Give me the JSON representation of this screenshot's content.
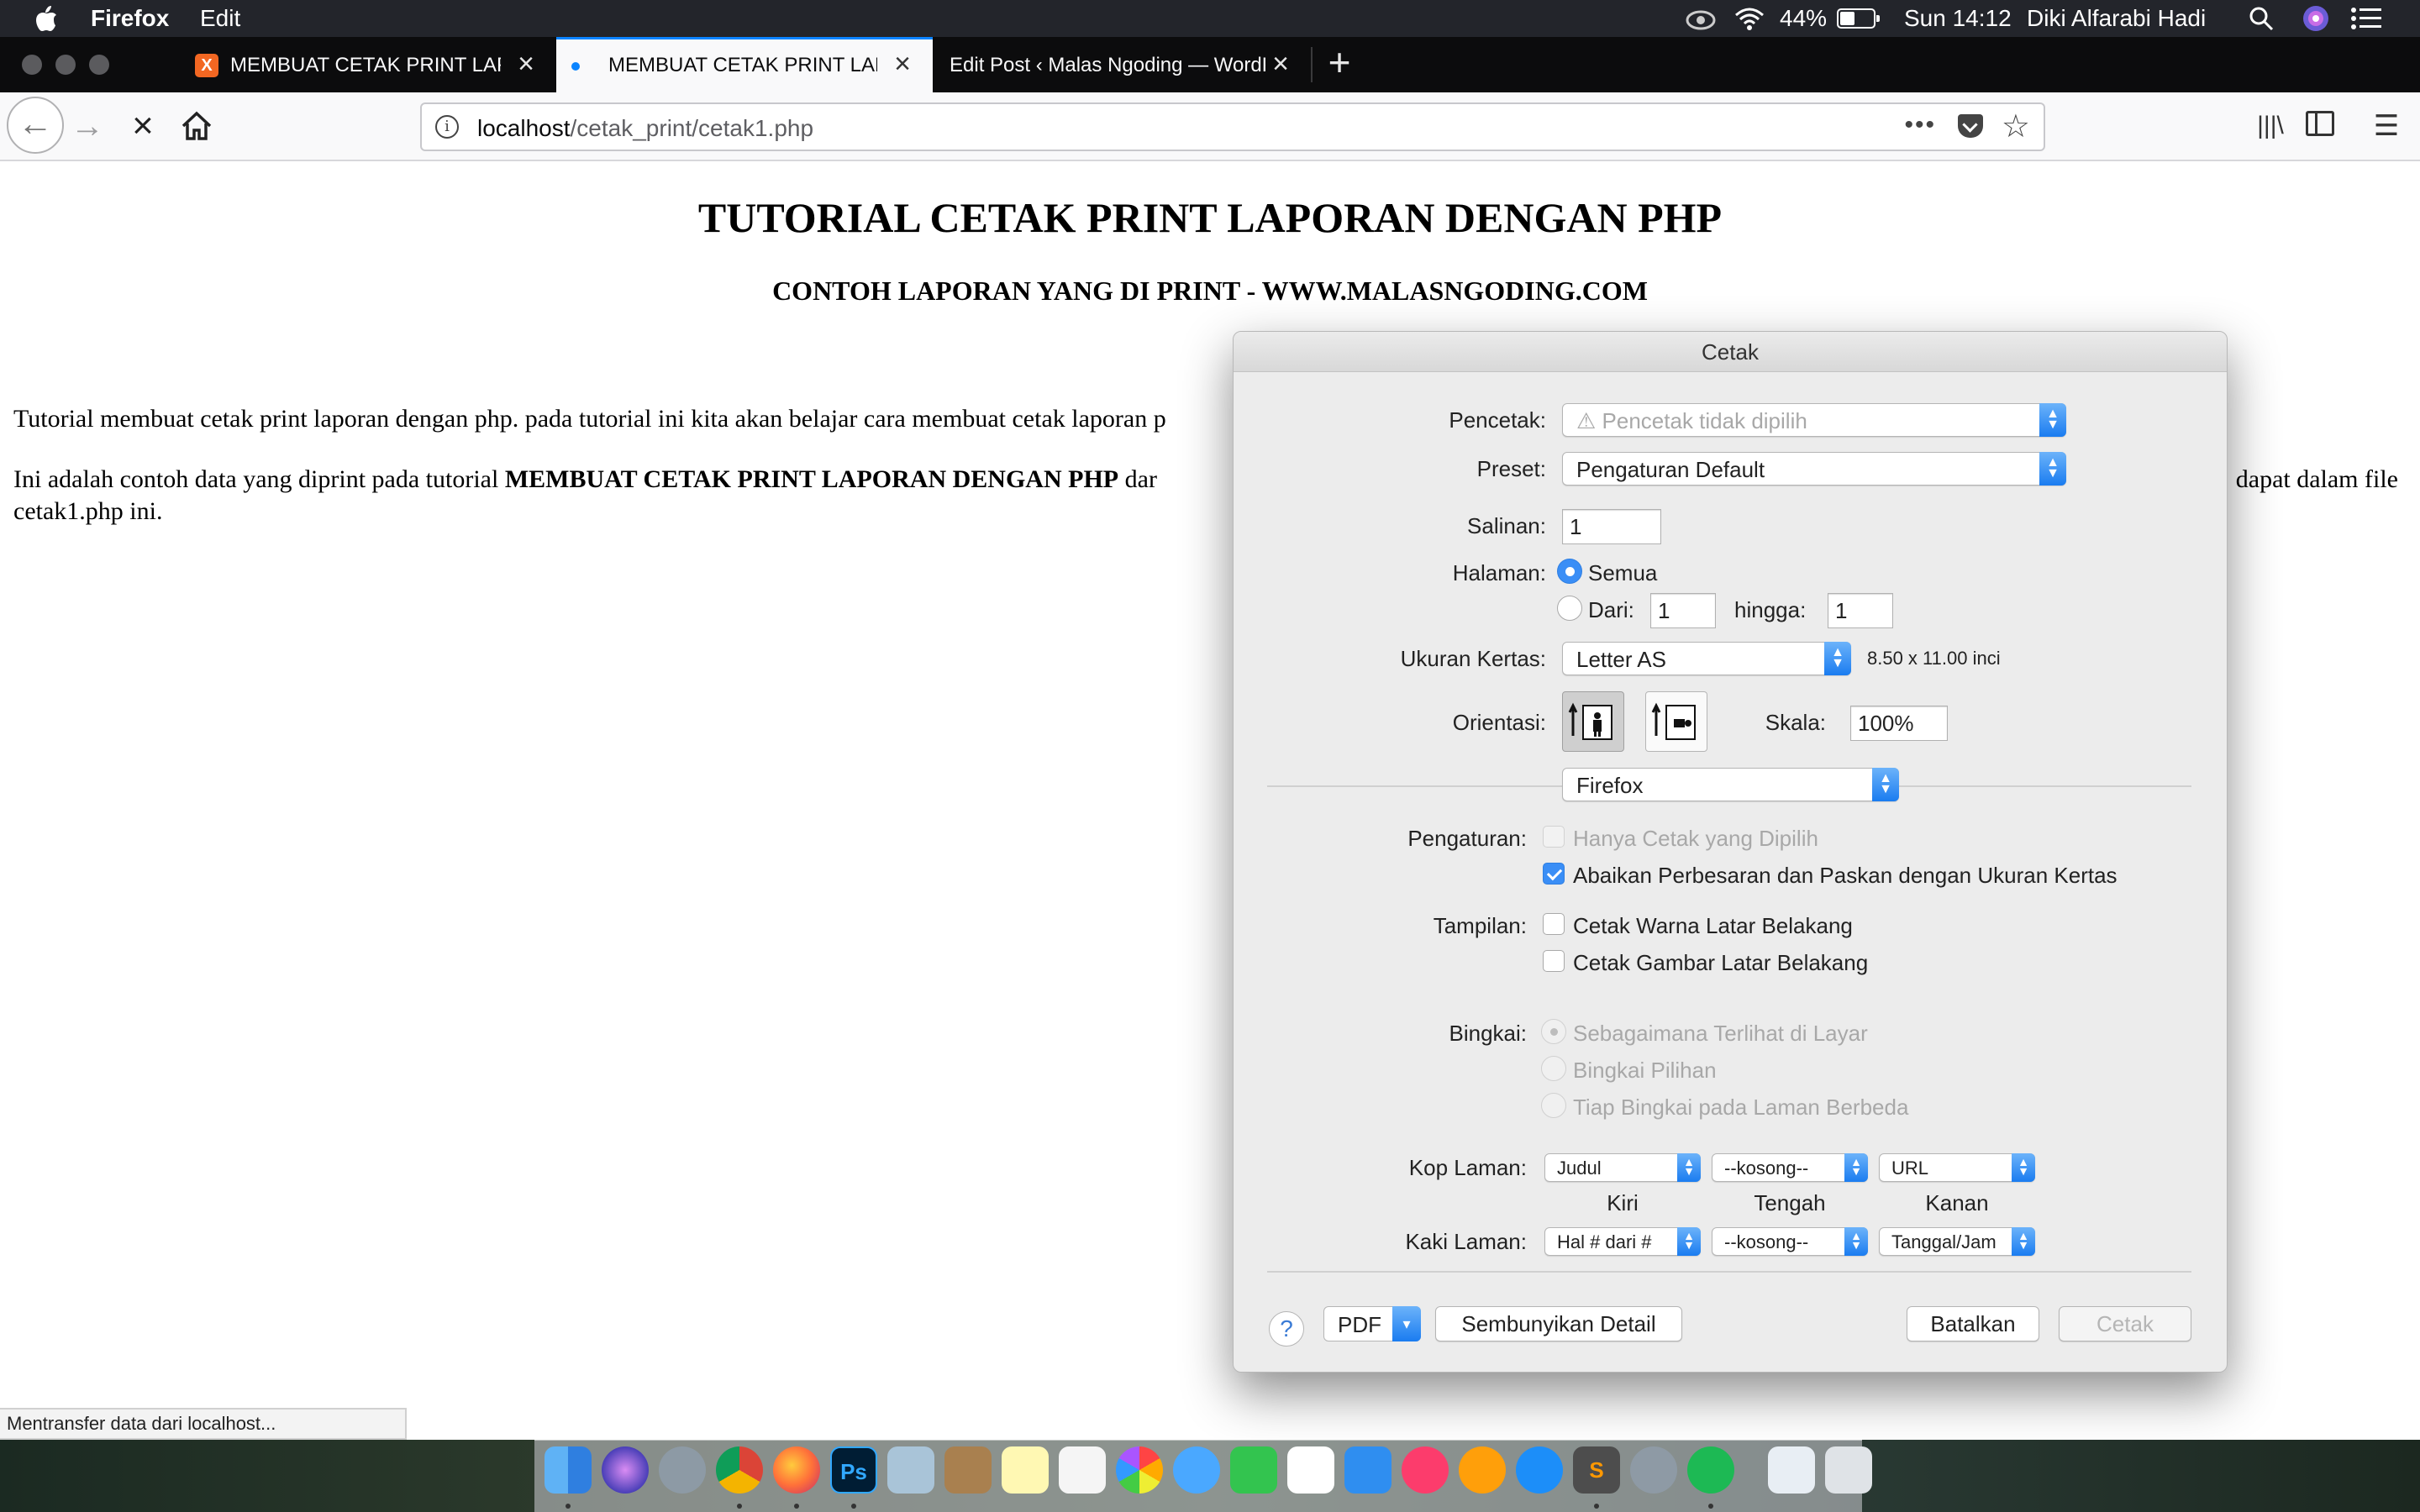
{
  "menubar": {
    "app_name": "Firefox",
    "menu_edit": "Edit",
    "battery": "44%",
    "clock": "Sun 14:12",
    "user": "Diki Alfarabi Hadi"
  },
  "tabs": [
    {
      "title": "MEMBUAT CETAK PRINT LAPORAN DENGAN PHP",
      "favicon": "X"
    },
    {
      "title": "MEMBUAT CETAK PRINT LAPORAN DENGAN PHP"
    },
    {
      "title": "Edit Post ‹ Malas Ngoding — WordPress"
    }
  ],
  "address": {
    "host": "localhost",
    "path": "/cetak_print/cetak1.php"
  },
  "page": {
    "heading": "TUTORIAL CETAK PRINT LAPORAN DENGAN PHP",
    "subheading": "CONTOH LAPORAN YANG DI PRINT - WWW.MALASNGODING.COM",
    "para1": "Tutorial membuat cetak print laporan dengan php. pada tutorial ini kita akan belajar cara membuat cetak laporan p",
    "para2_start": "Ini adalah contoh data yang diprint pada tutorial ",
    "para2_bold": "MEMBUAT CETAK PRINT LAPORAN DENGAN PHP",
    "para2_mid": " dar",
    "para2_end": "dapat dalam file",
    "para2_line2": "cetak1.php ini."
  },
  "statusbar": "Mentransfer data dari localhost...",
  "print_dialog": {
    "title": "Cetak",
    "printer_label": "Pencetak:",
    "printer_value": "Pencetak tidak dipilih",
    "preset_label": "Preset:",
    "preset_value": "Pengaturan Default",
    "copies_label": "Salinan:",
    "copies_value": "1",
    "pages_label": "Halaman:",
    "pages_all": "Semua",
    "pages_from": "Dari:",
    "pages_from_value": "1",
    "pages_to": "hingga:",
    "pages_to_value": "1",
    "paper_label": "Ukuran Kertas:",
    "paper_value": "Letter AS",
    "paper_dims": "8.50 x 11.00 inci",
    "orientation_label": "Orientasi:",
    "scale_label": "Skala:",
    "scale_value": "100%",
    "section_value": "Firefox",
    "settings_label": "Pengaturan:",
    "opt_selection": "Hanya Cetak yang Dipilih",
    "opt_shrink": "Abaikan Perbesaran dan Paskan dengan Ukuran Kertas",
    "appearance_label": "Tampilan:",
    "opt_bgcolor": "Cetak Warna Latar Belakang",
    "opt_bgimage": "Cetak Gambar Latar Belakang",
    "frames_label": "Bingkai:",
    "frame_screen": "Sebagaimana Terlihat di Layar",
    "frame_selected": "Bingkai Pilihan",
    "frame_each": "Tiap Bingkai pada Laman Berbeda",
    "header_label": "Kop Laman:",
    "header_left": "Judul",
    "header_center": "--kosong--",
    "header_right": "URL",
    "col_left": "Kiri",
    "col_center": "Tengah",
    "col_right": "Kanan",
    "footer_label": "Kaki Laman:",
    "footer_left": "Hal # dari #",
    "footer_center": "--kosong--",
    "footer_right": "Tanggal/Jam",
    "help": "?",
    "pdf": "PDF",
    "hide_details": "Sembunyikan Detail",
    "cancel": "Batalkan",
    "print": "Cetak"
  },
  "dock": {
    "apps": [
      "finder-icon",
      "siri-icon",
      "launchpad-icon",
      "chrome-icon",
      "firefox-icon",
      "photoshop-icon",
      "preview-icon",
      "contacts-icon",
      "notes-icon",
      "reminders-icon",
      "photos-icon",
      "messages-icon",
      "facetime-icon",
      "numbers-icon",
      "keynote-icon",
      "music-icon",
      "books-icon",
      "appstore-icon",
      "sublime-icon",
      "settings-icon",
      "spotify-icon",
      "finder-folder-icon",
      "trash-icon"
    ],
    "photoshop_label": "Ps"
  }
}
